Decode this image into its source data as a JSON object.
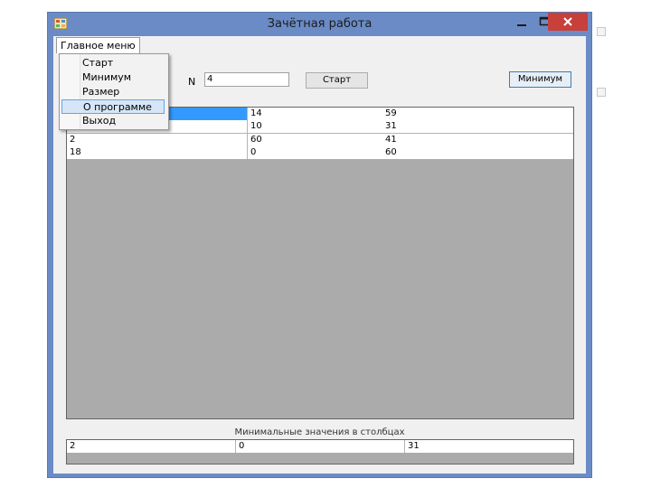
{
  "window": {
    "title": "Зачётная работа"
  },
  "menu": {
    "header_label": "Главное меню",
    "items": [
      {
        "label": "Старт",
        "highlighted": false
      },
      {
        "label": "Минимум",
        "highlighted": false
      },
      {
        "label": "Размер",
        "highlighted": false
      },
      {
        "label": "О программе",
        "highlighted": true
      },
      {
        "label": "Выход",
        "highlighted": false
      }
    ]
  },
  "controls": {
    "n_label": "N",
    "n_value": "4",
    "start_button": "Старт",
    "minimum_button": "Минимум"
  },
  "matrix": {
    "rows": [
      [
        "",
        "14",
        "59"
      ],
      [
        "",
        "10",
        "31"
      ],
      [
        "2",
        "60",
        "41"
      ],
      [
        "18",
        "0",
        "60"
      ]
    ],
    "selected_cell": [
      0,
      0
    ]
  },
  "minimums": {
    "caption": "Минимальные значения в столбцах",
    "values": [
      "2",
      "0",
      "31"
    ]
  },
  "colors": {
    "title_bar": "#6b8bc6",
    "close_button": "#c7403a",
    "selection": "#3399ff",
    "grid_background": "#ababab",
    "menu_highlight": "#d6e6f7"
  }
}
